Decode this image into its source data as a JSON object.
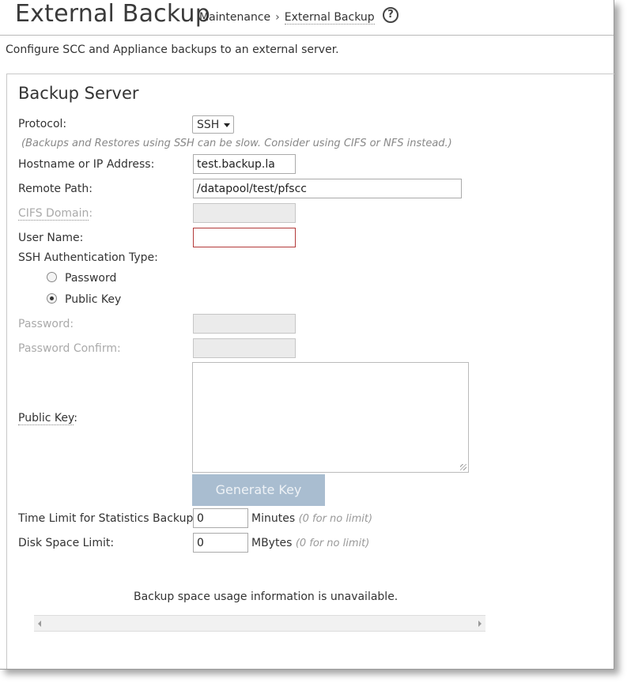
{
  "header": {
    "title": "External Backup",
    "breadcrumb": {
      "parent": "Maintenance",
      "separator": "›",
      "current": "External Backup"
    },
    "help_icon": "question-circle-icon"
  },
  "subtitle": "Configure SCC and Appliance backups to an external server.",
  "section": {
    "title": "Backup Server",
    "protocol": {
      "label": "Protocol:",
      "value": "SSH",
      "hint": "(Backups and Restores using SSH can be slow. Consider using CIFS or NFS instead.)"
    },
    "hostname": {
      "label": "Hostname or IP Address:",
      "value": "test.backup.la"
    },
    "remote_path": {
      "label": "Remote Path:",
      "value": "/datapool/test/pfscc"
    },
    "cifs_domain": {
      "label": "CIFS Domain",
      "colon": ":",
      "value": ""
    },
    "user_name": {
      "label": "User Name:",
      "value": ""
    },
    "ssh_auth": {
      "label": "SSH Authentication Type:",
      "options": [
        {
          "label": "Password",
          "selected": false
        },
        {
          "label": "Public Key",
          "selected": true
        }
      ]
    },
    "password": {
      "label": "Password:",
      "value": ""
    },
    "password_confirm": {
      "label": "Password Confirm:",
      "value": ""
    },
    "public_key": {
      "label": "Public Key",
      "colon": ":",
      "value": ""
    },
    "generate_key_label": "Generate Key",
    "time_limit": {
      "label": "Time Limit for Statistics Backup:",
      "value": "0",
      "unit": "Minutes",
      "note": "(0 for no limit)"
    },
    "disk_space": {
      "label": "Disk Space Limit:",
      "value": "0",
      "unit": "MBytes",
      "note": "(0 for no limit)"
    }
  },
  "usage_message": "Backup space usage information is unavailable.",
  "colors": {
    "error_border": "#b33a3a",
    "button_disabled": "#a9bdd0"
  }
}
